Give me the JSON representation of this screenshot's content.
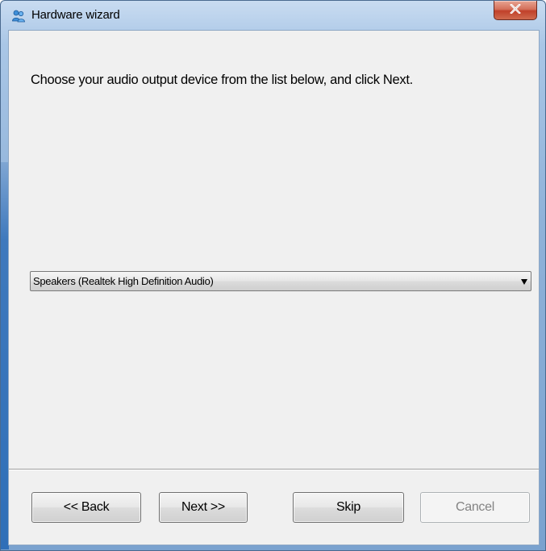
{
  "window": {
    "title": "Hardware wizard",
    "close_icon": "close-icon"
  },
  "main": {
    "instruction": "Choose your audio output device from the list below, and click Next.",
    "device_select": {
      "selected_value": "Speakers (Realtek High Definition Audio)"
    }
  },
  "footer": {
    "back_label": "<< Back",
    "next_label": "Next >>",
    "skip_label": "Skip",
    "cancel_label": "Cancel"
  },
  "colors": {
    "accent": "#2f6fb8",
    "close_button": "#c0402a",
    "client_background": "#f0f0f0"
  }
}
